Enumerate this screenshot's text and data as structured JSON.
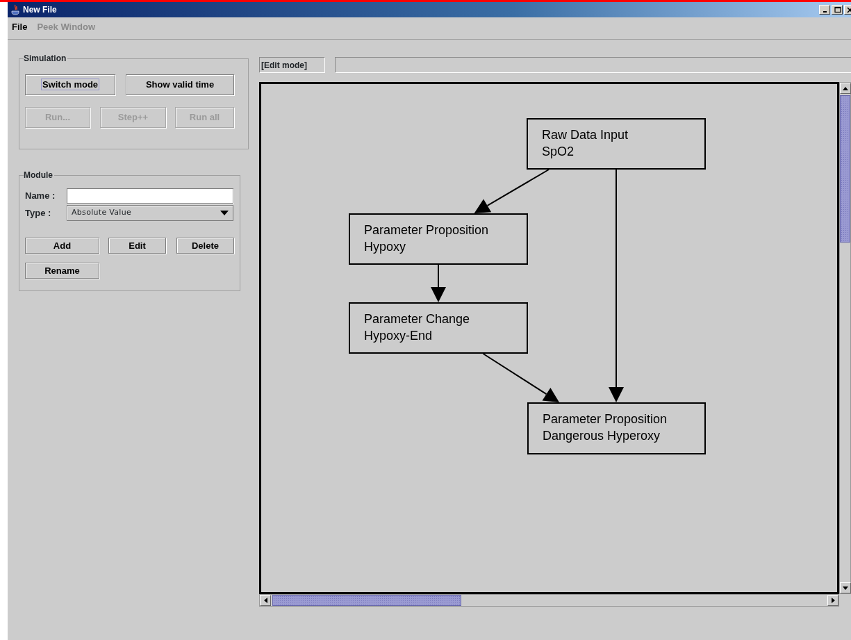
{
  "window": {
    "title": "New File"
  },
  "menu": [
    {
      "label": "File",
      "disabled": false
    },
    {
      "label": "Peek Window",
      "disabled": true
    }
  ],
  "simulation": {
    "title": "Simulation",
    "buttons": [
      {
        "label": "Switch mode",
        "disabled": false,
        "focused": true
      },
      {
        "label": "Show valid time",
        "disabled": false,
        "focused": false
      },
      {
        "label": "Run...",
        "disabled": true,
        "focused": false
      },
      {
        "label": "Step++",
        "disabled": true,
        "focused": false
      },
      {
        "label": "Run all",
        "disabled": true,
        "focused": false
      }
    ]
  },
  "module": {
    "title": "Module",
    "name_label": "Name :",
    "type_label": "Type :",
    "type_value": "Absolute Value",
    "buttons": [
      {
        "label": "Add",
        "disabled": false,
        "focused": false
      },
      {
        "label": "Edit",
        "disabled": false,
        "focused": false
      },
      {
        "label": "Delete",
        "disabled": false,
        "focused": false
      },
      {
        "label": "Rename",
        "disabled": false,
        "focused": false
      }
    ]
  },
  "mode_label": "[Edit mode]",
  "diagram": {
    "nodes": [
      {
        "lines": [
          "Raw Data Input",
          "SpO2"
        ]
      },
      {
        "lines": [
          "Parameter Proposition",
          "Hypoxy"
        ]
      },
      {
        "lines": [
          "Parameter Change",
          "Hypoxy-End"
        ]
      },
      {
        "lines": [
          "Parameter Proposition",
          "Dangerous Hyperoxy"
        ]
      }
    ]
  }
}
